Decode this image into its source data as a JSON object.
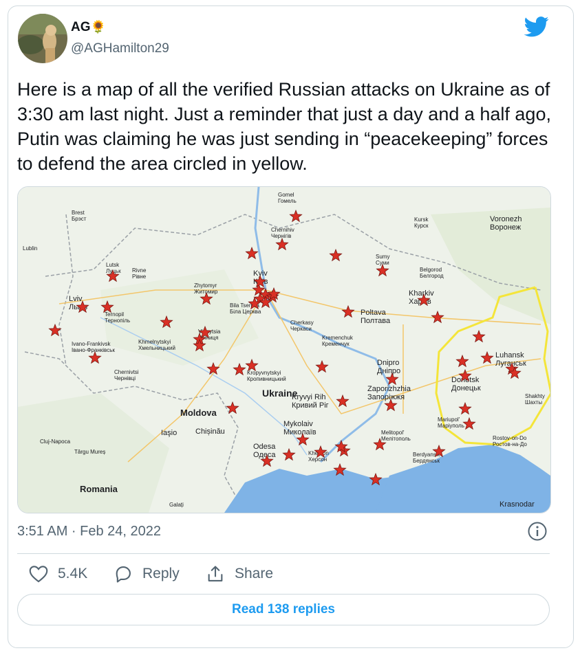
{
  "author": {
    "name": "AG",
    "name_emoji": "🌻",
    "handle": "@AGHamilton29"
  },
  "tweet": {
    "text": "Here is a map of all the verified Russian attacks on Ukraine as of 3:30 am last night. Just a reminder that just a day and a half ago, Putin was claiming he was just sending in “peacekeeping” forces to defend the area circled in yellow.",
    "timestamp": "3:51 AM · Feb 24, 2022"
  },
  "actions": {
    "likes": "5.4K",
    "reply_label": "Reply",
    "share_label": "Share"
  },
  "read_replies_label": "Read 138 replies",
  "map": {
    "country_label": "Ukraine",
    "cities": [
      {
        "id": "homel",
        "lines": [
          "Gomel",
          "Гомель"
        ]
      },
      {
        "id": "brest",
        "lines": [
          "Brest",
          "Брэст"
        ]
      },
      {
        "id": "lublin",
        "lines": [
          "Lublin"
        ]
      },
      {
        "id": "chernihiv",
        "lines": [
          "Chernihiv",
          "Чернігів"
        ]
      },
      {
        "id": "kursk",
        "lines": [
          "Kursk",
          "Курск"
        ]
      },
      {
        "id": "voronezh",
        "lines": [
          "Voronezh",
          "Воронеж"
        ]
      },
      {
        "id": "sumy",
        "lines": [
          "Sumy",
          "Суми"
        ]
      },
      {
        "id": "belgorod",
        "lines": [
          "Belgorod",
          "Белгород"
        ]
      },
      {
        "id": "lutsk",
        "lines": [
          "Lutsk",
          "Луцьк"
        ]
      },
      {
        "id": "rivne",
        "lines": [
          "Rivne",
          "Рівне"
        ]
      },
      {
        "id": "kyiv",
        "lines": [
          "Kyiv",
          "Київ"
        ]
      },
      {
        "id": "zhytomyr",
        "lines": [
          "Zhytomyr",
          "Житомир"
        ]
      },
      {
        "id": "kharkiv",
        "lines": [
          "Kharkiv",
          "Харків"
        ]
      },
      {
        "id": "lviv",
        "lines": [
          "Lviv",
          "Львів"
        ]
      },
      {
        "id": "ternopil",
        "lines": [
          "Ternopil",
          "Тернопіль"
        ]
      },
      {
        "id": "bilatserkva",
        "lines": [
          "Bila Tserkva",
          "Біла Церква"
        ]
      },
      {
        "id": "cherkasy",
        "lines": [
          "Cherkasy",
          "Черкаси"
        ]
      },
      {
        "id": "poltava",
        "lines": [
          "Poltava",
          "Полтава"
        ]
      },
      {
        "id": "vinnytsia",
        "lines": [
          "Vinnytsia",
          "Вінниця"
        ]
      },
      {
        "id": "ivanofrankivsk",
        "lines": [
          "Ivano-Frankivsk",
          "Івано-Франківськ"
        ]
      },
      {
        "id": "khmelnytskyi",
        "lines": [
          "Khmelnytskyi",
          "Хмельницький"
        ]
      },
      {
        "id": "kremenchuk",
        "lines": [
          "Kremenchuk",
          "Кременчук"
        ]
      },
      {
        "id": "luhansk",
        "lines": [
          "Luhansk",
          "Луганськ"
        ]
      },
      {
        "id": "dnipro",
        "lines": [
          "Dnipro",
          "Дніпро"
        ]
      },
      {
        "id": "chernivtsi",
        "lines": [
          "Chernivtsi",
          "Чернівці"
        ]
      },
      {
        "id": "kropyvnytskyi",
        "lines": [
          "Kropyvnytskyi",
          "Кропивницький"
        ]
      },
      {
        "id": "donetsk",
        "lines": [
          "Donetsk",
          "Донецьк"
        ]
      },
      {
        "id": "zaporizhzhia",
        "lines": [
          "Zaporizhzhia",
          "Запоріжжя"
        ]
      },
      {
        "id": "kryvyirih",
        "lines": [
          "Kryvyi Rih",
          "Кривий Ріг"
        ]
      },
      {
        "id": "moldova",
        "lines": [
          "Moldova"
        ]
      },
      {
        "id": "shakhty",
        "lines": [
          "Shakhty",
          "Шахты"
        ]
      },
      {
        "id": "mykolaiv",
        "lines": [
          "Mykolaiv",
          "Миколаїв"
        ]
      },
      {
        "id": "mariupol",
        "lines": [
          "Mariupol'",
          "Маріуполь"
        ]
      },
      {
        "id": "iasi",
        "lines": [
          "Iaşio"
        ]
      },
      {
        "id": "chisinau",
        "lines": [
          "Chișinău"
        ]
      },
      {
        "id": "clujnapoca",
        "lines": [
          "Cluj-Napoca"
        ]
      },
      {
        "id": "melitopol",
        "lines": [
          "Melitopol'",
          "Мелітополь"
        ]
      },
      {
        "id": "rostov",
        "lines": [
          "Rostov-on-Do",
          "Ростов-на-До"
        ]
      },
      {
        "id": "odesa",
        "lines": [
          "Odesa",
          "Одеса"
        ]
      },
      {
        "id": "kherson",
        "lines": [
          "Kherson",
          "Херсон"
        ]
      },
      {
        "id": "targumures",
        "lines": [
          "Târgu Mureș"
        ]
      },
      {
        "id": "berdiansk",
        "lines": [
          "Berdyans'k",
          "Бердянськ"
        ]
      },
      {
        "id": "romania",
        "lines": [
          "Romania"
        ]
      },
      {
        "id": "galati",
        "lines": [
          "Galați"
        ]
      },
      {
        "id": "krasnodar",
        "lines": [
          "Krasnodar"
        ]
      }
    ],
    "attack_count": 52,
    "colors": {
      "star": "#d93025",
      "circle": "#f4e53a",
      "water": "#7fb3e6",
      "land": "#eef2ea"
    }
  },
  "colors": {
    "accent": "#1d9bf0",
    "muted_text": "#536471",
    "border": "#cfd9de"
  }
}
